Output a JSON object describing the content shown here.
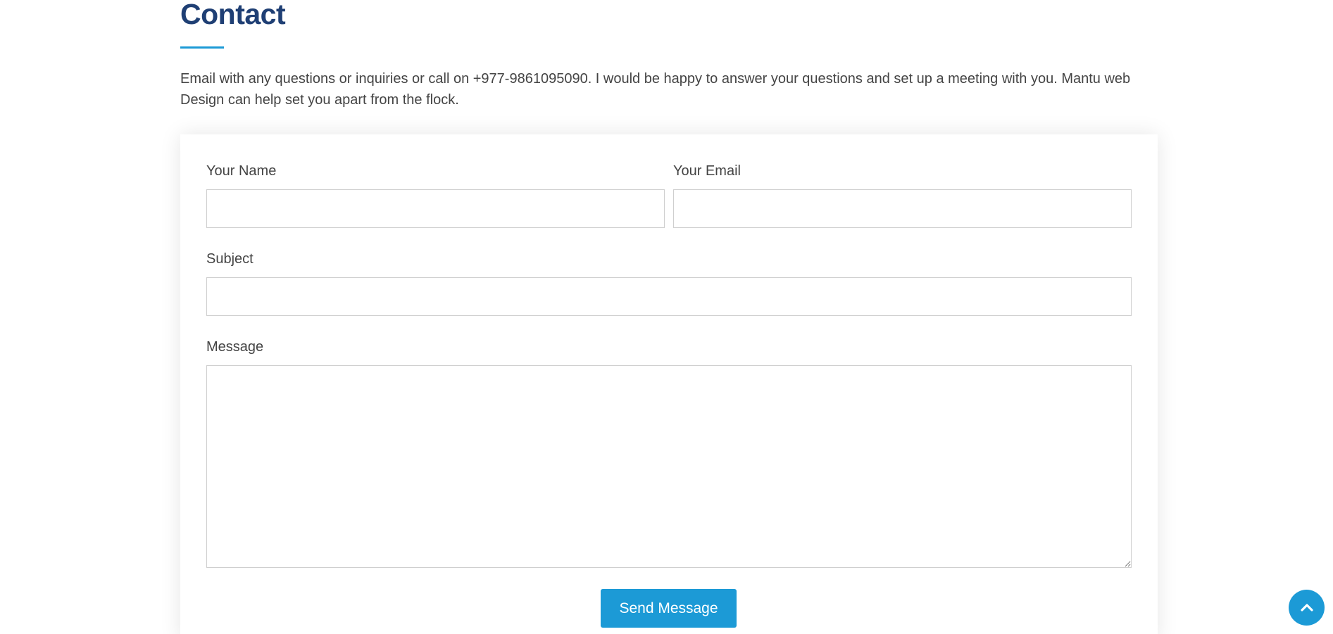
{
  "section": {
    "title": "Contact",
    "intro": "Email with any questions or inquiries or call on +977-9861095090. I would be happy to answer your questions and set up a meeting with you. Mantu web Design can help set you apart from the flock."
  },
  "form": {
    "name_label": "Your Name",
    "name_value": "",
    "email_label": "Your Email",
    "email_value": "",
    "subject_label": "Subject",
    "subject_value": "",
    "message_label": "Message",
    "message_value": "",
    "submit_label": "Send Message"
  },
  "back_to_top": {
    "icon": "chevron-up-icon"
  },
  "colors": {
    "heading": "#1f3f74",
    "accent": "#1c9ad6",
    "body_text": "#444444",
    "input_border": "#cfcfcf"
  }
}
